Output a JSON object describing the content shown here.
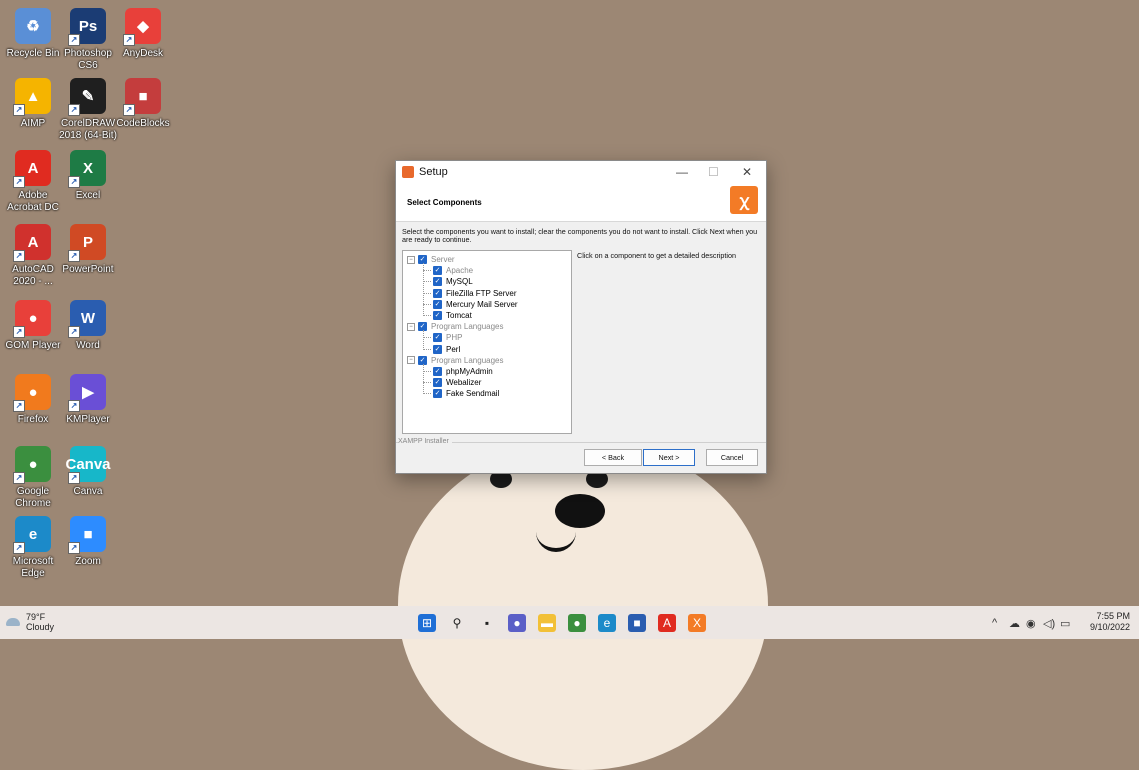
{
  "desktop": {
    "icons": [
      {
        "label": "Recycle Bin",
        "color": "#5a8fd6",
        "glyph": "♻"
      },
      {
        "label": "Photoshop CS6",
        "color": "#1b3c74",
        "glyph": "Ps"
      },
      {
        "label": "AnyDesk",
        "color": "#e8403a",
        "glyph": "◆"
      },
      {
        "label": "AIMP",
        "color": "#f5b400",
        "glyph": "▲"
      },
      {
        "label": "CorelDRAW 2018 (64-Bit)",
        "color": "#1f1f1f",
        "glyph": "✎"
      },
      {
        "label": "CodeBlocks",
        "color": "#c43d3d",
        "glyph": "■"
      },
      {
        "label": "Adobe Acrobat DC",
        "color": "#e02b20",
        "glyph": "A"
      },
      {
        "label": "Excel",
        "color": "#1e7b45",
        "glyph": "X"
      },
      {
        "label": "AutoCAD 2020 - ...",
        "color": "#d0312d",
        "glyph": "A"
      },
      {
        "label": "PowerPoint",
        "color": "#d04a24",
        "glyph": "P"
      },
      {
        "label": "GOM Player",
        "color": "#e8403a",
        "glyph": "●"
      },
      {
        "label": "Word",
        "color": "#2a5db0",
        "glyph": "W"
      },
      {
        "label": "Firefox",
        "color": "#f17a1d",
        "glyph": "●"
      },
      {
        "label": "KMPlayer",
        "color": "#6a4fd6",
        "glyph": "▶"
      },
      {
        "label": "Google Chrome",
        "color": "#3b8f3f",
        "glyph": "●"
      },
      {
        "label": "Canva",
        "color": "#17b7c9",
        "glyph": "Canva"
      },
      {
        "label": "Microsoft Edge",
        "color": "#1c8ac9",
        "glyph": "e"
      },
      {
        "label": "Zoom",
        "color": "#2d8cff",
        "glyph": "■"
      }
    ]
  },
  "window": {
    "title": "Setup",
    "minimize": "—",
    "maximize": "☐",
    "close": "✕",
    "header_title": "Select Components",
    "description": "Select the components you want to install; clear the components you do not want to install. Click Next when you are ready to continue.",
    "side_hint": "Click on a component to get a detailed description",
    "installer_label": "XAMPP Installer",
    "buttons": {
      "back": "< Back",
      "next": "Next >",
      "cancel": "Cancel"
    },
    "tree": [
      {
        "label": "Server",
        "level": 0,
        "greyed": true,
        "expander": "⊟"
      },
      {
        "label": "Apache",
        "level": 1,
        "greyed": true
      },
      {
        "label": "MySQL",
        "level": 1,
        "greyed": false
      },
      {
        "label": "FileZilla FTP Server",
        "level": 1,
        "greyed": false
      },
      {
        "label": "Mercury Mail Server",
        "level": 1,
        "greyed": false
      },
      {
        "label": "Tomcat",
        "level": 1,
        "greyed": false
      },
      {
        "label": "Program Languages",
        "level": 0,
        "greyed": true,
        "expander": "⊟"
      },
      {
        "label": "PHP",
        "level": 1,
        "greyed": true
      },
      {
        "label": "Perl",
        "level": 1,
        "greyed": false
      },
      {
        "label": "Program Languages",
        "level": 0,
        "greyed": true,
        "expander": "⊟"
      },
      {
        "label": "phpMyAdmin",
        "level": 1,
        "greyed": false
      },
      {
        "label": "Webalizer",
        "level": 1,
        "greyed": false
      },
      {
        "label": "Fake Sendmail",
        "level": 1,
        "greyed": false
      }
    ]
  },
  "taskbar": {
    "weather_temp": "79°F",
    "weather_desc": "Cloudy",
    "time": "7:55 PM",
    "date": "9/10/2022",
    "apps": [
      {
        "name": "start-button",
        "color": "#1f6fd6",
        "glyph": "⊞"
      },
      {
        "name": "search",
        "color": "#ece6e3",
        "glyph": "⚲"
      },
      {
        "name": "task-view",
        "color": "#ece6e3",
        "glyph": "▪"
      },
      {
        "name": "chat",
        "color": "#5b5fc7",
        "glyph": "●"
      },
      {
        "name": "file-explorer",
        "color": "#f2c037",
        "glyph": "▬"
      },
      {
        "name": "chrome",
        "color": "#3b8f3f",
        "glyph": "●"
      },
      {
        "name": "edge",
        "color": "#1c8ac9",
        "glyph": "e"
      },
      {
        "name": "store",
        "color": "#2a5db0",
        "glyph": "■"
      },
      {
        "name": "acrobat",
        "color": "#e02b20",
        "glyph": "A"
      },
      {
        "name": "xampp",
        "color": "#f37b26",
        "glyph": "X"
      }
    ],
    "tray": [
      "^",
      "☁",
      "◉",
      "◁)",
      "▭"
    ]
  }
}
